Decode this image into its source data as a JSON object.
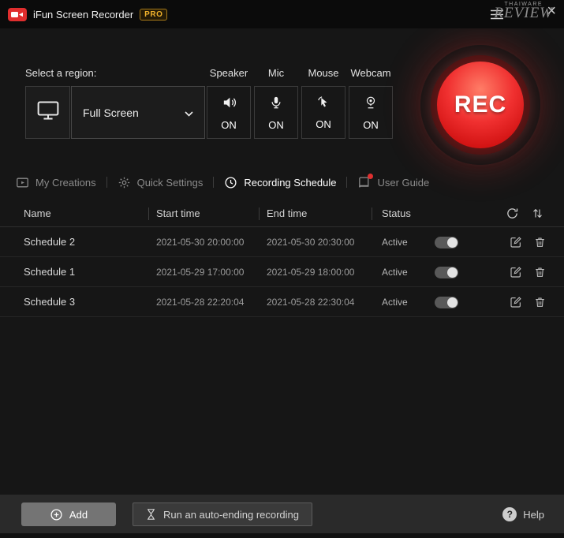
{
  "titlebar": {
    "title": "iFun Screen Recorder",
    "badge": "PRO"
  },
  "watermark": {
    "line1": "THAIWARE",
    "line2": "REVIEW"
  },
  "icons": {
    "close": "×",
    "help": "?"
  },
  "region": {
    "label": "Select a region:",
    "dropdown_value": "Full Screen"
  },
  "sources": [
    {
      "label": "Speaker",
      "state": "ON"
    },
    {
      "label": "Mic",
      "state": "ON"
    },
    {
      "label": "Mouse",
      "state": "ON"
    },
    {
      "label": "Webcam",
      "state": "ON"
    }
  ],
  "rec": {
    "label": "REC"
  },
  "tabs": [
    {
      "label": "My Creations",
      "active": false
    },
    {
      "label": "Quick Settings",
      "active": false
    },
    {
      "label": "Recording Schedule",
      "active": true
    },
    {
      "label": "User Guide",
      "active": false
    }
  ],
  "table": {
    "headers": {
      "name": "Name",
      "start": "Start time",
      "end": "End time",
      "status": "Status"
    },
    "rows": [
      {
        "name": "Schedule 2",
        "start": "2021-05-30 20:00:00",
        "end": "2021-05-30 20:30:00",
        "status": "Active",
        "enabled": true
      },
      {
        "name": "Schedule 1",
        "start": "2021-05-29 17:00:00",
        "end": "2021-05-29 18:00:00",
        "status": "Active",
        "enabled": true
      },
      {
        "name": "Schedule 3",
        "start": "2021-05-28 22:20:04",
        "end": "2021-05-28 22:30:04",
        "status": "Active",
        "enabled": true
      }
    ]
  },
  "footer": {
    "add_label": "Add",
    "run_label": "Run an auto-ending recording",
    "help_label": "Help"
  },
  "colors": {
    "accent_red": "#e02e2e",
    "rec_red": "#f03030",
    "badge_yellow": "#f0b12c"
  }
}
